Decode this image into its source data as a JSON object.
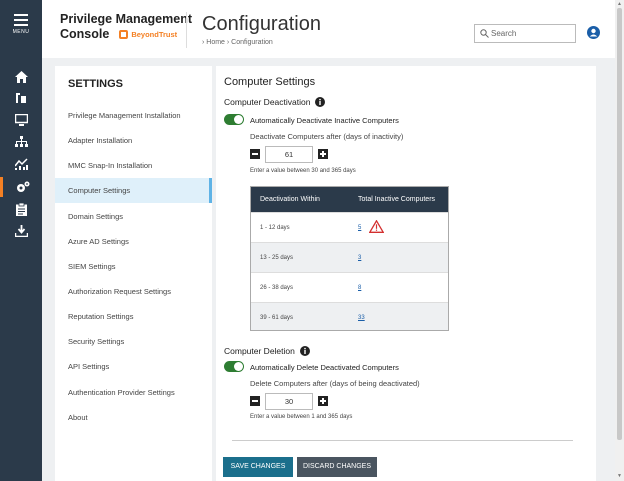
{
  "nav": {
    "menu_label": "MENU",
    "icons": [
      "home-icon",
      "tools-icon",
      "monitor-icon",
      "org-chart-icon",
      "analytics-icon",
      "settings-gear-icon",
      "clipboard-icon",
      "download-icon"
    ],
    "active_color": "#f48024"
  },
  "header": {
    "product_line1": "Privilege Management",
    "product_line2": "Console",
    "brand": "BeyondTrust",
    "title": "Configuration",
    "breadcrumb": "›  Home  ›  Configuration",
    "search_placeholder": "Search"
  },
  "settings": {
    "title": "SETTINGS",
    "items": [
      "Privilege Management Installation",
      "Adapter Installation",
      "MMC Snap-In Installation",
      "Computer Settings",
      "Domain Settings",
      "Azure AD Settings",
      "SIEM Settings",
      "Authorization Request Settings",
      "Reputation Settings",
      "Security Settings",
      "API Settings",
      "Authentication Provider Settings",
      "About"
    ],
    "active": "Computer Settings"
  },
  "main": {
    "title": "Computer Settings",
    "deactivation": {
      "title": "Computer Deactivation",
      "toggle_label": "Automatically Deactivate Inactive Computers",
      "field_label": "Deactivate Computers after (days of inactivity)",
      "value": "61",
      "hint": "Enter a value between 30 and 365 days"
    },
    "table": {
      "headers": [
        "Deactivation Within",
        "Total Inactive Computers"
      ],
      "rows": [
        {
          "range": "1 - 12 days",
          "count": "5",
          "warning": true
        },
        {
          "range": "13 - 25 days",
          "count": "3",
          "warning": false
        },
        {
          "range": "26 - 38 days",
          "count": "8",
          "warning": false
        },
        {
          "range": "39 - 61 days",
          "count": "33",
          "warning": false
        }
      ]
    },
    "deletion": {
      "title": "Computer Deletion",
      "toggle_label": "Automatically Delete Deactivated Computers",
      "field_label": "Delete Computers after (days of being deactivated)",
      "value": "30",
      "hint": "Enter a value between 1 and 365 days"
    },
    "save_label": "SAVE CHANGES",
    "discard_label": "DISCARD CHANGES"
  }
}
